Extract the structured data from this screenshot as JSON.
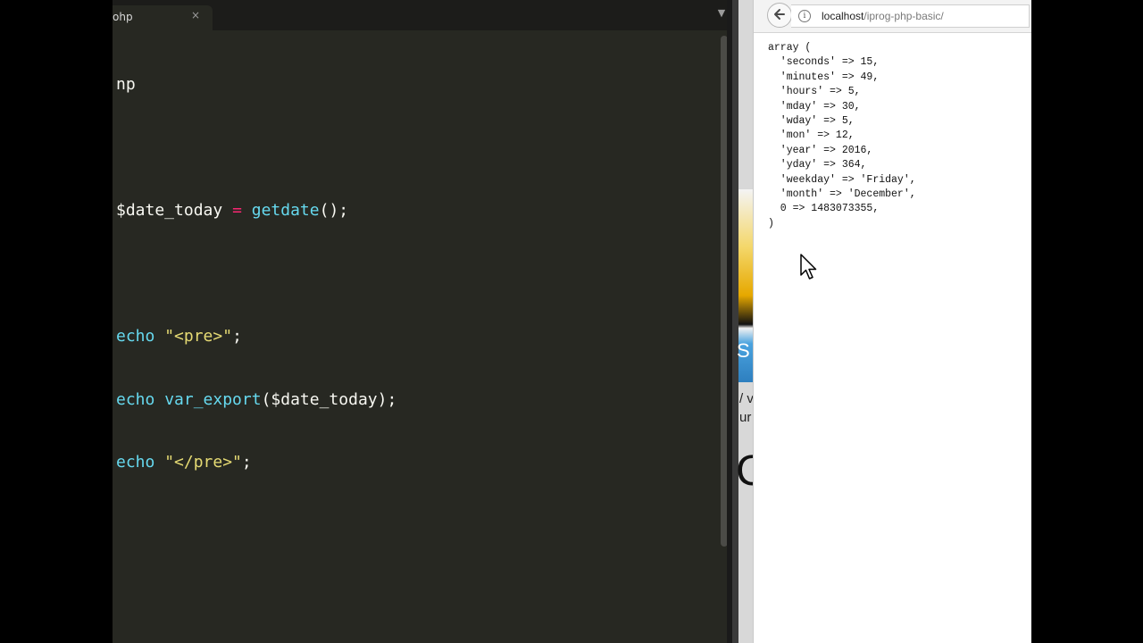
{
  "editor": {
    "tab_title": "ohp",
    "tab_close": "×",
    "tab_menu": "▼",
    "code": {
      "line1": "np",
      "line3_var": "$date_today",
      "line3_op": "=",
      "line3_fn": "getdate",
      "line3_rest": "();",
      "line5_kw": "echo",
      "line5_str": "\"<pre>\"",
      "line5_end": ";",
      "line6_kw": "echo",
      "line6_fn": "var_export",
      "line6_rest": "($date_today);",
      "line7_kw": "echo",
      "line7_str": "\"</pre>\"",
      "line7_end": ";"
    }
  },
  "background_window": {
    "letter": "S",
    "text1": "/ v",
    "text2": "ur",
    "text3": "C"
  },
  "browser": {
    "url_host": "localhost",
    "url_path": "/iprog-php-basic/",
    "info_icon": "i",
    "output_lines": [
      "array (",
      "  'seconds' => 15,",
      "  'minutes' => 49,",
      "  'hours' => 5,",
      "  'mday' => 30,",
      "  'wday' => 5,",
      "  'mon' => 12,",
      "  'year' => 2016,",
      "  'yday' => 364,",
      "  'weekday' => 'Friday',",
      "  'month' => 'December',",
      "  0 => 1483073355,",
      ")"
    ]
  },
  "icons": {
    "back": "back-arrow-icon",
    "info": "info-icon",
    "cursor": "mouse-pointer-icon"
  }
}
